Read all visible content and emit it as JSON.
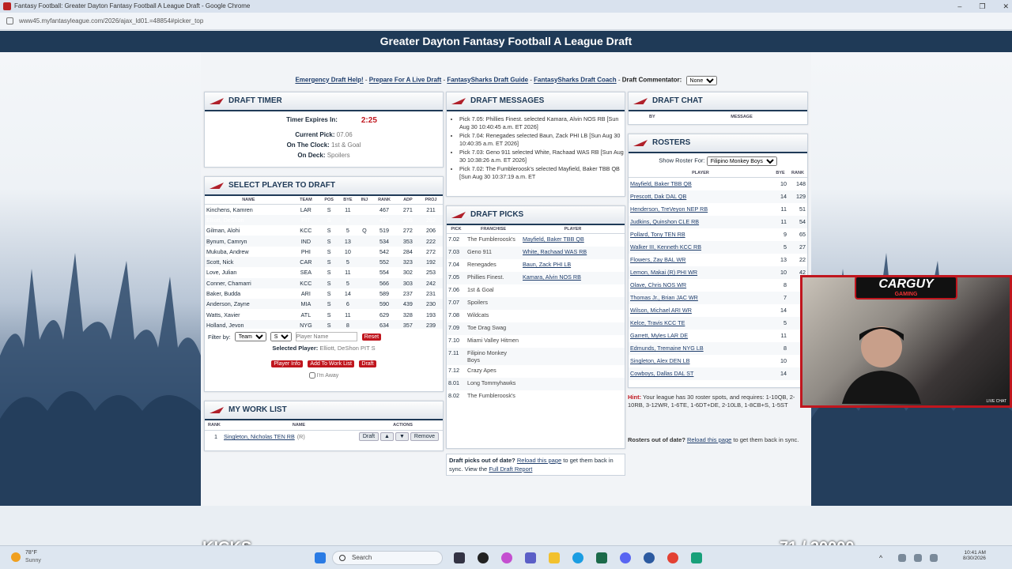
{
  "browser": {
    "tab_title": "Fantasy Football: Greater Dayton Fantasy Football A League Draft - Google Chrome",
    "url": "www45.myfantasyleague.com/2026/ajax_ld01.=48854#picker_top",
    "controls": [
      "–",
      "❐",
      "✕"
    ]
  },
  "banner": {
    "title": "Greater Dayton Fantasy Football A League Draft"
  },
  "links": {
    "emergency": "Emergency Draft Help!",
    "prepare": "Prepare For A Live Draft",
    "sharks_guide": "FantasySharks Draft Guide",
    "sharks_coach": "FantasySharks Draft Coach",
    "commentator_label": "Draft Commentator:",
    "commentator_value": "None",
    "sep": " - "
  },
  "timer": {
    "title": "DRAFT TIMER",
    "expires_label": "Timer Expires In:",
    "expires_value": "2:25",
    "current_pick_label": "Current Pick:",
    "current_pick_value": "07.06",
    "on_clock_label": "On The Clock:",
    "on_clock_value": "1st & Goal",
    "on_deck_label": "On Deck:",
    "on_deck_value": "Spoilers"
  },
  "select_player": {
    "title": "SELECT PLAYER TO DRAFT",
    "columns": [
      "NAME",
      "TEAM",
      "POS",
      "BYE",
      "INJ",
      "RANK",
      "ADP",
      "PROJ"
    ],
    "rows": [
      {
        "name": "Kinchens, Kamren",
        "team": "LAR",
        "pos": "S",
        "bye": "11",
        "inj": "",
        "rank": "467",
        "adp": "271",
        "proj": "211"
      },
      {
        "name": "Elliott, DeShon",
        "team": "PIT",
        "pos": "S",
        "bye": "9",
        "inj": "",
        "rank": "492",
        "adp": "205",
        "proj": "262"
      },
      {
        "name": "Gilman, Alohi",
        "team": "KCC",
        "pos": "S",
        "bye": "5",
        "inj": "Q",
        "rank": "519",
        "adp": "272",
        "proj": "206"
      },
      {
        "name": "Bynum, Camryn",
        "team": "IND",
        "pos": "S",
        "bye": "13",
        "inj": "",
        "rank": "534",
        "adp": "353",
        "proj": "222"
      },
      {
        "name": "Mukuba, Andrew",
        "team": "PHI",
        "pos": "S",
        "bye": "10",
        "inj": "",
        "rank": "542",
        "adp": "284",
        "proj": "272"
      },
      {
        "name": "Scott, Nick",
        "team": "CAR",
        "pos": "S",
        "bye": "5",
        "inj": "",
        "rank": "552",
        "adp": "323",
        "proj": "192"
      },
      {
        "name": "Love, Julian",
        "team": "SEA",
        "pos": "S",
        "bye": "11",
        "inj": "",
        "rank": "554",
        "adp": "302",
        "proj": "253"
      },
      {
        "name": "Conner, Chamarri",
        "team": "KCC",
        "pos": "S",
        "bye": "5",
        "inj": "",
        "rank": "566",
        "adp": "303",
        "proj": "242"
      },
      {
        "name": "Baker, Budda",
        "team": "ARI",
        "pos": "S",
        "bye": "14",
        "inj": "",
        "rank": "589",
        "adp": "237",
        "proj": "231"
      },
      {
        "name": "Anderson, Zayne",
        "team": "MIA",
        "pos": "S",
        "bye": "6",
        "inj": "",
        "rank": "590",
        "adp": "439",
        "proj": "230"
      },
      {
        "name": "Watts, Xavier",
        "team": "ATL",
        "pos": "S",
        "bye": "11",
        "inj": "",
        "rank": "629",
        "adp": "328",
        "proj": "193"
      },
      {
        "name": "Holland, Jevon",
        "team": "NYG",
        "pos": "S",
        "bye": "8",
        "inj": "",
        "rank": "634",
        "adp": "357",
        "proj": "239"
      }
    ],
    "filter_label": "Filter by:",
    "filter_team": "Team",
    "filter_pos": "S",
    "player_name_placeholder": "Player Name",
    "reset": "Reset",
    "selected_label": "Selected Player:",
    "selected_value": "Elliott, DeShon PIT S",
    "player_info": "Player Info",
    "add_work": "Add To Work List",
    "draft": "Draft",
    "away_label": "I'm Away"
  },
  "work_list": {
    "title": "MY WORK LIST",
    "col_rank": "RANK",
    "col_name": "NAME",
    "col_actions": "ACTIONS",
    "item_num": "1",
    "item_name": "Singleton, Nicholas TEN RB",
    "item_flag": "(R)",
    "draft": "Draft",
    "up": "▲",
    "down": "▼",
    "remove": "Remove"
  },
  "messages": {
    "title": "DRAFT MESSAGES",
    "items": [
      "Pick 7.05: Phillies Finest. selected Kamara, Alvin NOS RB [Sun Aug 30 10:40:45 a.m. ET 2026]",
      "Pick 7.04: Renegades selected Baun, Zack PHI LB [Sun Aug 30 10:40:35 a.m. ET 2026]",
      "Pick 7.03: Geno 911 selected White, Rachaad WAS RB [Sun Aug 30 10:38:26 a.m. ET 2026]",
      "Pick 7.02: The Fumbleroosk's selected Mayfield, Baker TBB QB [Sun Aug 30 10:37:19 a.m. ET"
    ]
  },
  "picks": {
    "title": "DRAFT PICKS",
    "col_pick": "PICK",
    "col_franchise": "FRANCHISE",
    "col_player": "PLAYER",
    "rows": [
      {
        "pick": "7.02",
        "franchise": "The Fumbleroosk's",
        "player": "Mayfield, Baker TBB QB"
      },
      {
        "pick": "7.03",
        "franchise": "Geno 911",
        "player": "White, Rachaad WAS RB"
      },
      {
        "pick": "7.04",
        "franchise": "Renegades",
        "player": "Baun, Zack PHI LB"
      },
      {
        "pick": "7.05",
        "franchise": "Phillies Finest.",
        "player": "Kamara, Alvin NOS RB"
      },
      {
        "pick": "7.06",
        "franchise": "1st & Goal",
        "player": ""
      },
      {
        "pick": "7.07",
        "franchise": "Spoilers",
        "player": ""
      },
      {
        "pick": "7.08",
        "franchise": "Wildcats",
        "player": ""
      },
      {
        "pick": "7.09",
        "franchise": "Toe Drag Swag",
        "player": ""
      },
      {
        "pick": "7.10",
        "franchise": "Miami Valley Hitmen",
        "player": ""
      },
      {
        "pick": "7.11",
        "franchise": "Filipino Monkey Boys",
        "player": ""
      },
      {
        "pick": "7.12",
        "franchise": "Crazy Apes",
        "player": ""
      },
      {
        "pick": "8.01",
        "franchise": "Long Tommyhawks",
        "player": ""
      },
      {
        "pick": "8.02",
        "franchise": "The Fumbleroosk's",
        "player": ""
      }
    ],
    "footer_text1": "Draft picks out of date?",
    "footer_link1": "Reload this page",
    "footer_text2": "to get them back in sync. View the",
    "footer_link2": "Full Draft Report"
  },
  "chat": {
    "title": "DRAFT CHAT",
    "col_by": "BY",
    "col_message": "MESSAGE"
  },
  "rosters": {
    "title": "ROSTERS",
    "show_label": "Show Roster For:",
    "show_value": "Filipino Monkey Boys",
    "col_player": "PLAYER",
    "col_bye": "BYE",
    "col_rank": "RANK",
    "rows": [
      {
        "player": "Mayfield, Baker TBB QB",
        "bye": "10",
        "rank": "148"
      },
      {
        "player": "Prescott, Dak DAL QB",
        "bye": "14",
        "rank": "129"
      },
      {
        "player": "Henderson, TreVeyon NEP RB",
        "bye": "11",
        "rank": "51"
      },
      {
        "player": "Judkins, Quinshon CLE RB",
        "bye": "11",
        "rank": "54"
      },
      {
        "player": "Pollard, Tony TEN RB",
        "bye": "9",
        "rank": "65"
      },
      {
        "player": "Walker III, Kenneth KCC RB",
        "bye": "5",
        "rank": "27"
      },
      {
        "player": "Flowers, Zay BAL WR",
        "bye": "13",
        "rank": "22"
      },
      {
        "player": "Lemon, Makai (R) PHI WR",
        "bye": "10",
        "rank": "42"
      },
      {
        "player": "Olave, Chris NOS WR",
        "bye": "8",
        "rank": ""
      },
      {
        "player": "Thomas Jr., Brian JAC WR",
        "bye": "7",
        "rank": ""
      },
      {
        "player": "Wilson, Michael ARI WR",
        "bye": "14",
        "rank": ""
      },
      {
        "player": "Kelce, Travis KCC TE",
        "bye": "5",
        "rank": ""
      },
      {
        "player": "Garrett, Myles LAR DE",
        "bye": "11",
        "rank": ""
      },
      {
        "player": "Edmunds, Tremaine NYG LB",
        "bye": "8",
        "rank": ""
      },
      {
        "player": "Singleton, Alex DEN LB",
        "bye": "10",
        "rank": ""
      },
      {
        "player": "Cowboys, Dallas DAL ST",
        "bye": "14",
        "rank": ""
      }
    ],
    "hint_label": "Hint:",
    "hint_text": "Your league has 30 roster spots, and requires: 1-10QB, 2-10RB, 3-12WR, 1-6TE, 1-6DT+DE, 2-10LB, 1-8CB+S, 1-5ST",
    "footer_text1": "Rosters out of date?",
    "footer_link1": "Reload this page",
    "footer_text2": "to get them back in sync."
  },
  "stream": {
    "brand": "CARGUY",
    "sub": "GAMING",
    "live": "LIVE CHAT"
  },
  "overlay": {
    "kicks": "KICKS",
    "counter": "71 / 20000"
  },
  "taskbar": {
    "weather_temp": "78°F",
    "weather_desc": "Sunny",
    "search": "Search",
    "time": "10:41 AM",
    "date": "8/30/2026"
  }
}
